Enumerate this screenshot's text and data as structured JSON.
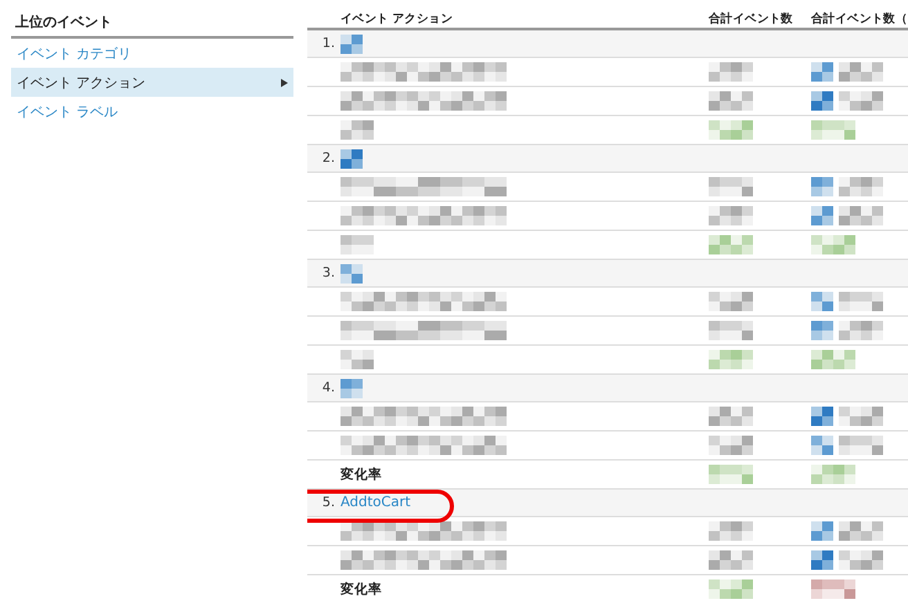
{
  "sidebar": {
    "heading": "上位のイベント",
    "items": [
      {
        "label": "イベント カテゴリ",
        "selected": false
      },
      {
        "label": "イベント アクション",
        "selected": true
      },
      {
        "label": "イベント ラベル",
        "selected": false
      }
    ]
  },
  "table": {
    "columns": [
      "イベント アクション",
      "合計イベント数",
      "合計イベント数（"
    ],
    "groups": [
      {
        "rank": "1.",
        "rows": [
          {
            "kind": "redacted"
          },
          {
            "kind": "redacted"
          },
          {
            "kind": "redacted_rate"
          }
        ]
      },
      {
        "rank": "2.",
        "rows": [
          {
            "kind": "redacted"
          },
          {
            "kind": "redacted"
          },
          {
            "kind": "redacted_rate"
          }
        ]
      },
      {
        "rank": "3.",
        "rows": [
          {
            "kind": "redacted"
          },
          {
            "kind": "redacted"
          },
          {
            "kind": "redacted_rate"
          }
        ]
      },
      {
        "rank": "4.",
        "rows": [
          {
            "kind": "redacted"
          },
          {
            "kind": "redacted"
          },
          {
            "kind": "rate",
            "label": "変化率"
          }
        ]
      },
      {
        "rank": "5.",
        "name": "AddtoCart",
        "highlighted": true,
        "rows": [
          {
            "kind": "redacted"
          },
          {
            "kind": "redacted"
          },
          {
            "kind": "rate",
            "label": "変化率"
          }
        ]
      }
    ]
  }
}
